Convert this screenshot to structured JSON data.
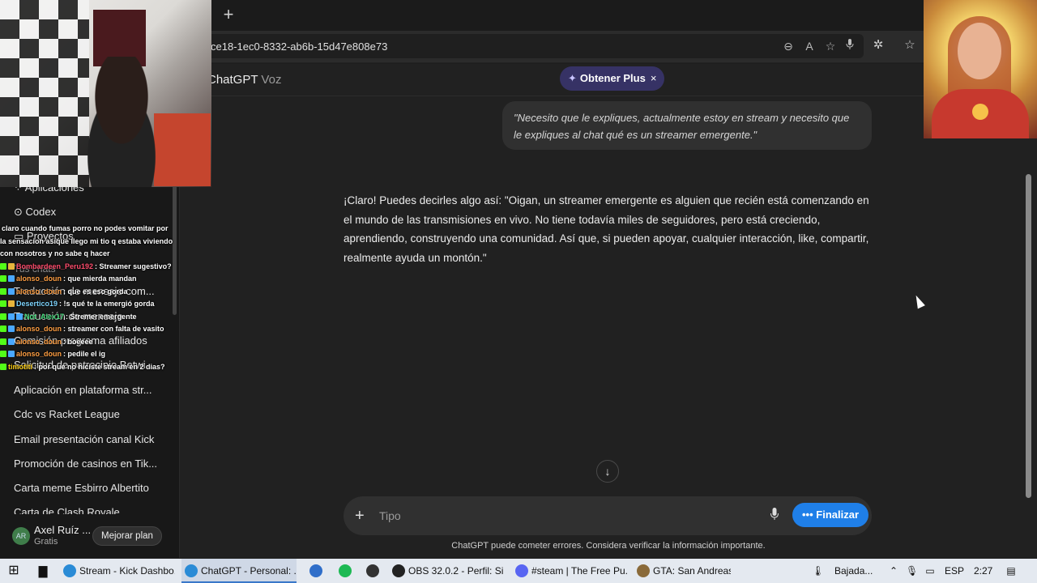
{
  "browser": {
    "new_tab_icon": "+",
    "url": "ce18-1ec0-8332-ab6b-15d47e808e73"
  },
  "header": {
    "model": "ChatGPT",
    "mode": "Voz",
    "plus_pill": "Obtener Plus",
    "plus_close": "×"
  },
  "conversation": {
    "user_message": "\"Necesito que le expliques, actualmente estoy en stream y necesito que le expliques al chat qué es un streamer emergente.\"",
    "assistant_message": "¡Claro! Puedes decirles algo así: \"Oigan, un streamer emergente es alguien que recién está comenzando en el mundo de las transmisiones en vivo. No tiene todavía miles de seguidores, pero está creciendo, aprendiendo, construyendo una comunidad. Así que, si pueden apoyar, cualquier interacción, like, compartir, realmente ayuda un montón.\""
  },
  "composer": {
    "placeholder": "Tipo",
    "finalize_label": "Finalizar",
    "disclaimer": "ChatGPT puede cometer errores. Considera verificar la información importante."
  },
  "sidebar": {
    "top_items": [
      "Aplicaciones",
      "Codex",
      "Proyectos"
    ],
    "chats_heading": "Tus chats",
    "chats": [
      "Traducción de mensaje com...",
      "Traducción de mensaje",
      "Comisión programa afiliados",
      "Solicitud de patrocinio Betwi...",
      "Aplicación en plataforma str...",
      "Cdc vs Racket League",
      "Email presentación canal Kick",
      "Promoción de casinos en Tik...",
      "Carta meme Esbirro Albertito",
      "Carta de Clash Royale"
    ],
    "user_name": "Axel Ruíz ...",
    "user_plan": "Gratis",
    "avatar_initials": "AR",
    "upgrade_label": "Mejorar plan"
  },
  "stream_chat": [
    {
      "user": "",
      "text": "claro cuando fumas porro no podes vomitar por la sensacion asique llego mi tio q estaba viviendo con nosotros y no sabe q hacer",
      "color": "#ffffff",
      "badges": []
    },
    {
      "user": "Bombardeen_Peru192",
      "text": ": Streamer sugestivo?",
      "color": "#ff4d6d",
      "badges": [
        "green",
        "gold"
      ]
    },
    {
      "user": "alonso_doun",
      "text": ": que mierda mandan",
      "color": "#ff9f43",
      "badges": [
        "green",
        "blue"
      ]
    },
    {
      "user": "alonso_doun",
      "text": ": que es eso gorda",
      "color": "#ff9f43",
      "badges": [
        "green",
        "blue"
      ]
    },
    {
      "user": "Desertico19",
      "text": ": !s qué te la emergió gorda",
      "color": "#7dd3fc",
      "badges": [
        "green",
        "gold"
      ]
    },
    {
      "user": "Not_Alex17",
      "text": ": Stremer emergente",
      "color": "#4ade80",
      "badges": [
        "green",
        "blue",
        "blue"
      ]
    },
    {
      "user": "alonso_doun",
      "text": ": streamer con falta de vasito",
      "color": "#ff9f43",
      "badges": [
        "green",
        "blue"
      ]
    },
    {
      "user": "alonso_doun",
      "text": ": boeeee",
      "color": "#ff9f43",
      "badges": [
        "green",
        "blue"
      ]
    },
    {
      "user": "alonso_doun",
      "text": ": pedile el ig",
      "color": "#ff9f43",
      "badges": [
        "green",
        "blue"
      ]
    },
    {
      "user": "timotiti",
      "text": ": por que no hiciste stream en 2 dias?",
      "color": "#facc15",
      "badges": [
        "green"
      ]
    }
  ],
  "taskbar": {
    "items": [
      {
        "label": "Stream - Kick Dashbo...",
        "icon": "edge-icon",
        "active": false
      },
      {
        "label": "ChatGPT - Personal: ...",
        "icon": "edge-icon",
        "active": true
      },
      {
        "label": "",
        "icon": "mail-icon",
        "active": false
      },
      {
        "label": "",
        "icon": "spotify-icon",
        "active": false
      },
      {
        "label": "",
        "icon": "terminal-icon",
        "active": false
      },
      {
        "label": "OBS 32.0.2 - Perfil: Sin...",
        "icon": "obs-icon",
        "active": false
      },
      {
        "label": "#steam | The Free Pu...",
        "icon": "discord-icon",
        "active": false
      },
      {
        "label": "GTA: San Andreas",
        "icon": "gta-icon",
        "active": false
      }
    ],
    "weather": "Bajada...",
    "language": "ESP",
    "time": "2:27"
  },
  "colors": {
    "accent": "#1f7fe8",
    "plus_pill": "#363265",
    "background": "#212121",
    "sidebar": "#181818"
  }
}
